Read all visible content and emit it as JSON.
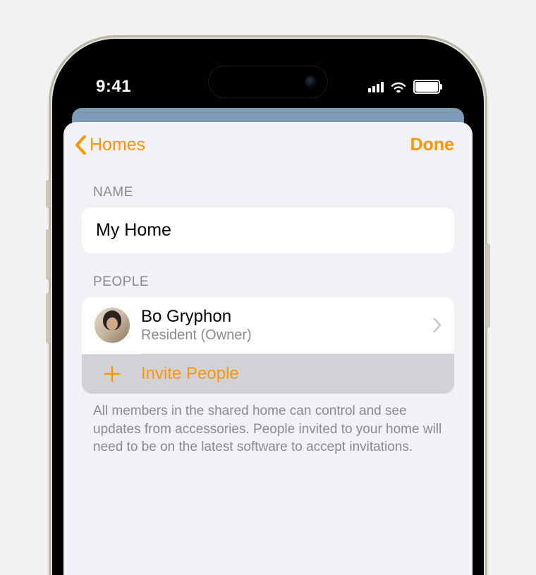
{
  "status": {
    "time": "9:41"
  },
  "nav": {
    "back_label": "Homes",
    "done_label": "Done"
  },
  "name_section": {
    "header": "NAME",
    "value": "My Home"
  },
  "people_section": {
    "header": "PEOPLE",
    "person": {
      "name": "Bo Gryphon",
      "role": "Resident (Owner)"
    },
    "invite_label": "Invite People",
    "footer": "All members in the shared home can control and see updates from accessories. People invited to your home will need to be on the latest software to accept invitations."
  },
  "colors": {
    "accent": "#ff9500"
  }
}
